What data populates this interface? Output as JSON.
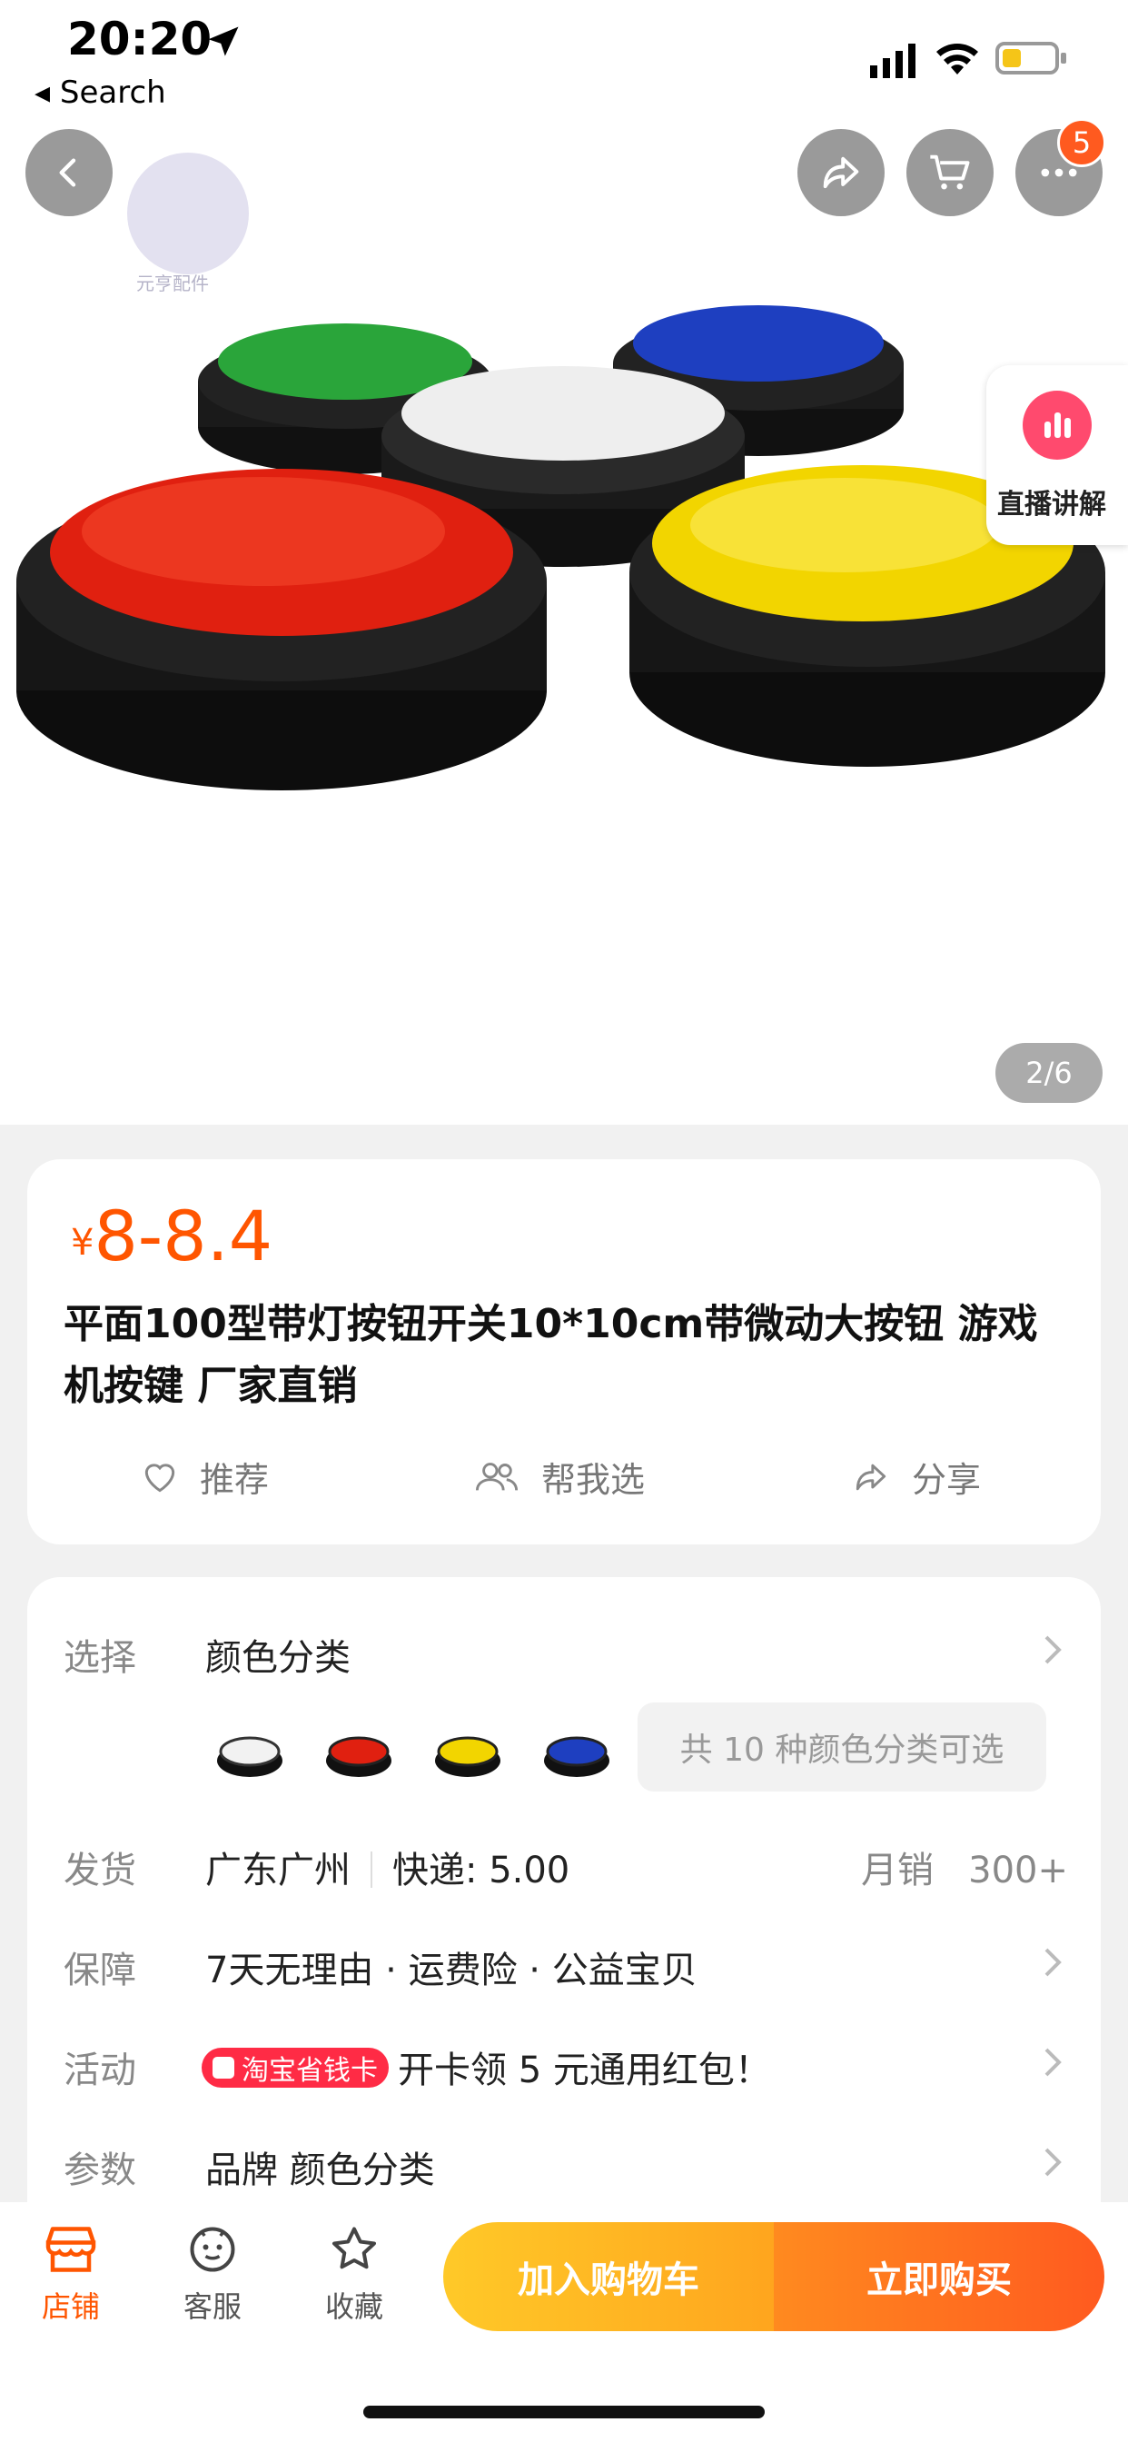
{
  "status_bar": {
    "time": "20:20",
    "back_label": "◂ Search",
    "icons": [
      "location-arrow-icon",
      "signal-icon",
      "wifi-icon",
      "battery-icon"
    ]
  },
  "header": {
    "cart_badge": "5",
    "watermark_text": "元亨配件",
    "icons": [
      "back-icon",
      "share-icon",
      "cart-icon",
      "more-icon"
    ]
  },
  "live_explain": {
    "label": "直播讲解"
  },
  "gallery": {
    "pager": "2/6"
  },
  "product": {
    "currency": "¥",
    "price": "8-8.4",
    "title": "平面100型带灯按钮开关10*10cm带微动大按钮 游戏机按键 厂家直销",
    "actions": [
      {
        "label": "推荐",
        "icon": "heart-icon"
      },
      {
        "label": "帮我选",
        "icon": "people-icon"
      },
      {
        "label": "分享",
        "icon": "share-icon"
      }
    ]
  },
  "specs": {
    "select": {
      "label": "选择",
      "value": "颜色分类",
      "swatches": [
        "white",
        "red",
        "yellow",
        "blue"
      ],
      "more": "共 10 种颜色分类可选"
    },
    "shipping": {
      "label": "发货",
      "origin": "广东广州",
      "express": "快递: 5.00",
      "monthly_label": "月销",
      "monthly_value": "300+"
    },
    "guarantee": {
      "label": "保障",
      "value": "7天无理由 · 运费险 · 公益宝贝"
    },
    "activity": {
      "label": "活动",
      "tag": "淘宝省钱卡",
      "value": "开卡领 5 元通用红包！"
    },
    "params": {
      "label": "参数",
      "value": "品牌 颜色分类"
    }
  },
  "bottom_bar": {
    "store": "店铺",
    "service": "客服",
    "favorite": "收藏",
    "add_cart": "加入购物车",
    "buy_now": "立即购买"
  },
  "colors": {
    "accent": "#ff5500",
    "cart_button": "#ffb622",
    "buy_button": "#ff6a1f",
    "badge": "#ff5a1f"
  }
}
